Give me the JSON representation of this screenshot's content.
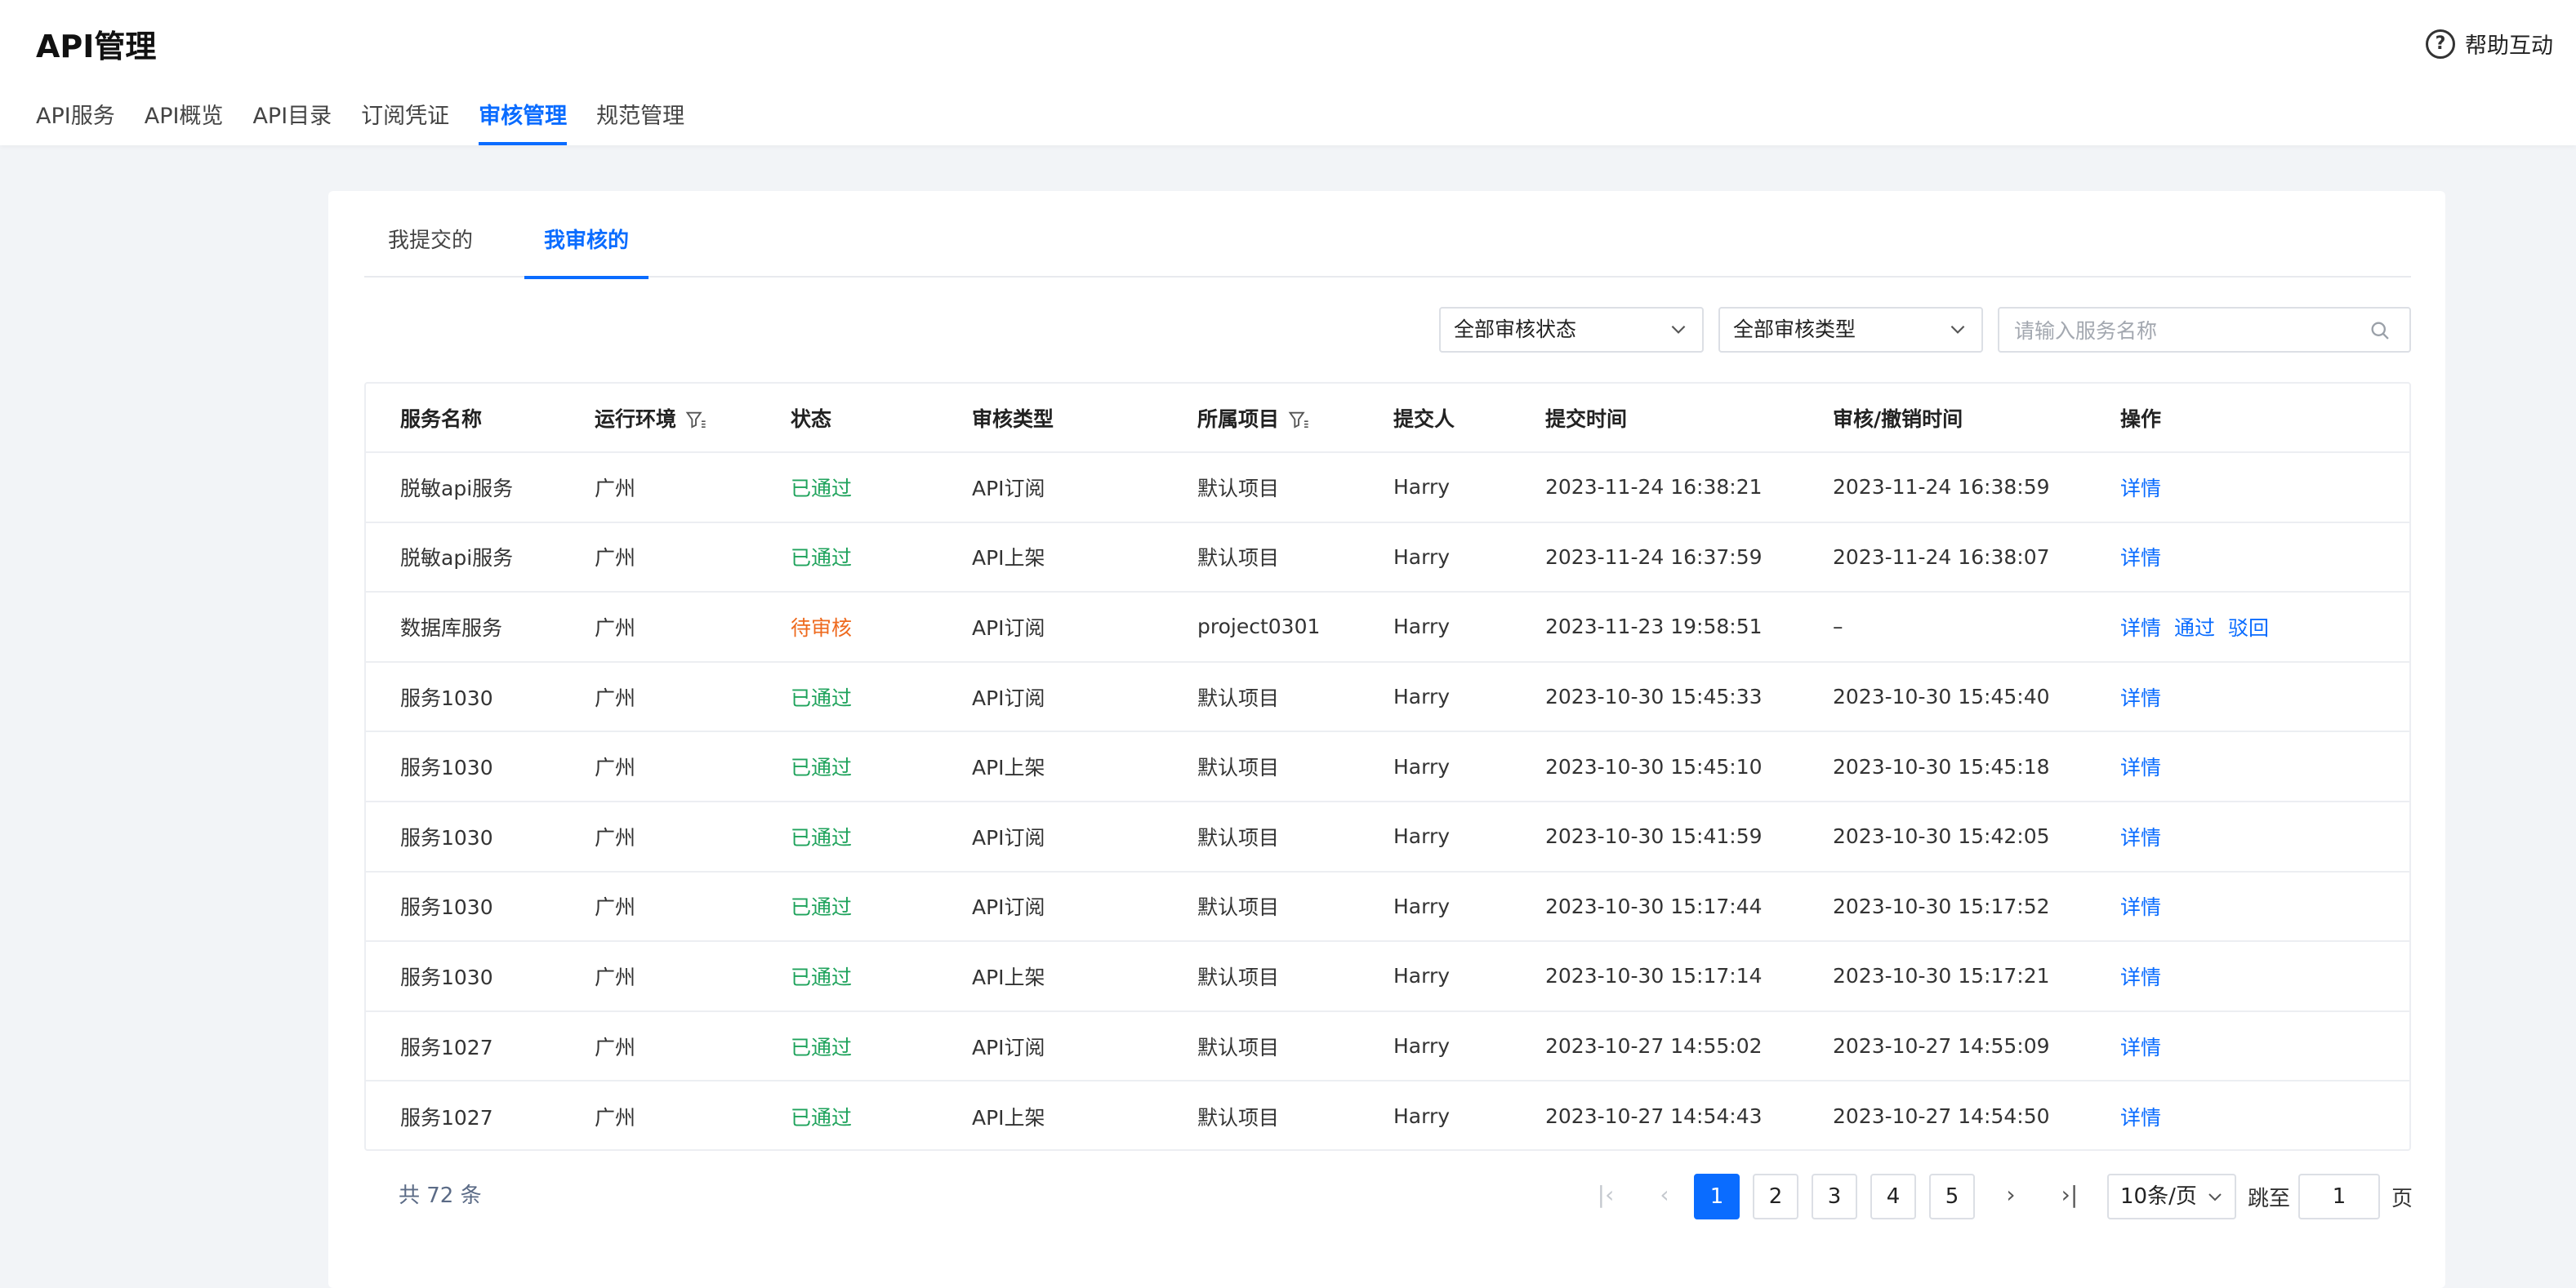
{
  "header": {
    "title": "API管理",
    "help_label": "帮助互动",
    "nav": [
      "API服务",
      "API概览",
      "API目录",
      "订阅凭证",
      "审核管理",
      "规范管理"
    ],
    "active_nav": "审核管理"
  },
  "subtabs": [
    "我提交的",
    "我审核的"
  ],
  "filters": {
    "status_select": "全部审核状态",
    "type_select": "全部审核类型",
    "search_placeholder": "请输入服务名称"
  },
  "table": {
    "columns": [
      "服务名称",
      "运行环境",
      "状态",
      "审核类型",
      "所属项目",
      "提交人",
      "提交时间",
      "审核/撤销时间",
      "操作"
    ],
    "rows": [
      {
        "name": "脱敏api服务",
        "env": "广州",
        "status": "已通过",
        "type": "API订阅",
        "project": "默认项目",
        "submitter": "Harry",
        "submit_time": "2023-11-24 16:38:21",
        "review_time": "2023-11-24 16:38:59",
        "ops": [
          "详情"
        ]
      },
      {
        "name": "脱敏api服务",
        "env": "广州",
        "status": "已通过",
        "type": "API上架",
        "project": "默认项目",
        "submitter": "Harry",
        "submit_time": "2023-11-24 16:37:59",
        "review_time": "2023-11-24 16:38:07",
        "ops": [
          "详情"
        ]
      },
      {
        "name": "数据库服务",
        "env": "广州",
        "status": "待审核",
        "type": "API订阅",
        "project": "project0301",
        "submitter": "Harry",
        "submit_time": "2023-11-23 19:58:51",
        "review_time": "–",
        "ops": [
          "详情",
          "通过",
          "驳回"
        ]
      },
      {
        "name": "服务1030",
        "env": "广州",
        "status": "已通过",
        "type": "API订阅",
        "project": "默认项目",
        "submitter": "Harry",
        "submit_time": "2023-10-30 15:45:33",
        "review_time": "2023-10-30 15:45:40",
        "ops": [
          "详情"
        ]
      },
      {
        "name": "服务1030",
        "env": "广州",
        "status": "已通过",
        "type": "API上架",
        "project": "默认项目",
        "submitter": "Harry",
        "submit_time": "2023-10-30 15:45:10",
        "review_time": "2023-10-30 15:45:18",
        "ops": [
          "详情"
        ]
      },
      {
        "name": "服务1030",
        "env": "广州",
        "status": "已通过",
        "type": "API订阅",
        "project": "默认项目",
        "submitter": "Harry",
        "submit_time": "2023-10-30 15:41:59",
        "review_time": "2023-10-30 15:42:05",
        "ops": [
          "详情"
        ]
      },
      {
        "name": "服务1030",
        "env": "广州",
        "status": "已通过",
        "type": "API订阅",
        "project": "默认项目",
        "submitter": "Harry",
        "submit_time": "2023-10-30 15:17:44",
        "review_time": "2023-10-30 15:17:52",
        "ops": [
          "详情"
        ]
      },
      {
        "name": "服务1030",
        "env": "广州",
        "status": "已通过",
        "type": "API上架",
        "project": "默认项目",
        "submitter": "Harry",
        "submit_time": "2023-10-30 15:17:14",
        "review_time": "2023-10-30 15:17:21",
        "ops": [
          "详情"
        ]
      },
      {
        "name": "服务1027",
        "env": "广州",
        "status": "已通过",
        "type": "API订阅",
        "project": "默认项目",
        "submitter": "Harry",
        "submit_time": "2023-10-27 14:55:02",
        "review_time": "2023-10-27 14:55:09",
        "ops": [
          "详情"
        ]
      },
      {
        "name": "服务1027",
        "env": "广州",
        "status": "已通过",
        "type": "API上架",
        "project": "默认项目",
        "submitter": "Harry",
        "submit_time": "2023-10-27 14:54:43",
        "review_time": "2023-10-27 14:54:50",
        "ops": [
          "详情"
        ]
      }
    ]
  },
  "pagination": {
    "total_label": "共 72 条",
    "pages": [
      "1",
      "2",
      "3",
      "4",
      "5"
    ],
    "current_page": "1",
    "page_size": "10条/页",
    "jump_label": "跳至",
    "jump_value": "1",
    "page_unit": "页"
  },
  "colors": {
    "accent": "#0a6cff",
    "passed": "#1fa35c",
    "pending": "#ee6a1e"
  }
}
